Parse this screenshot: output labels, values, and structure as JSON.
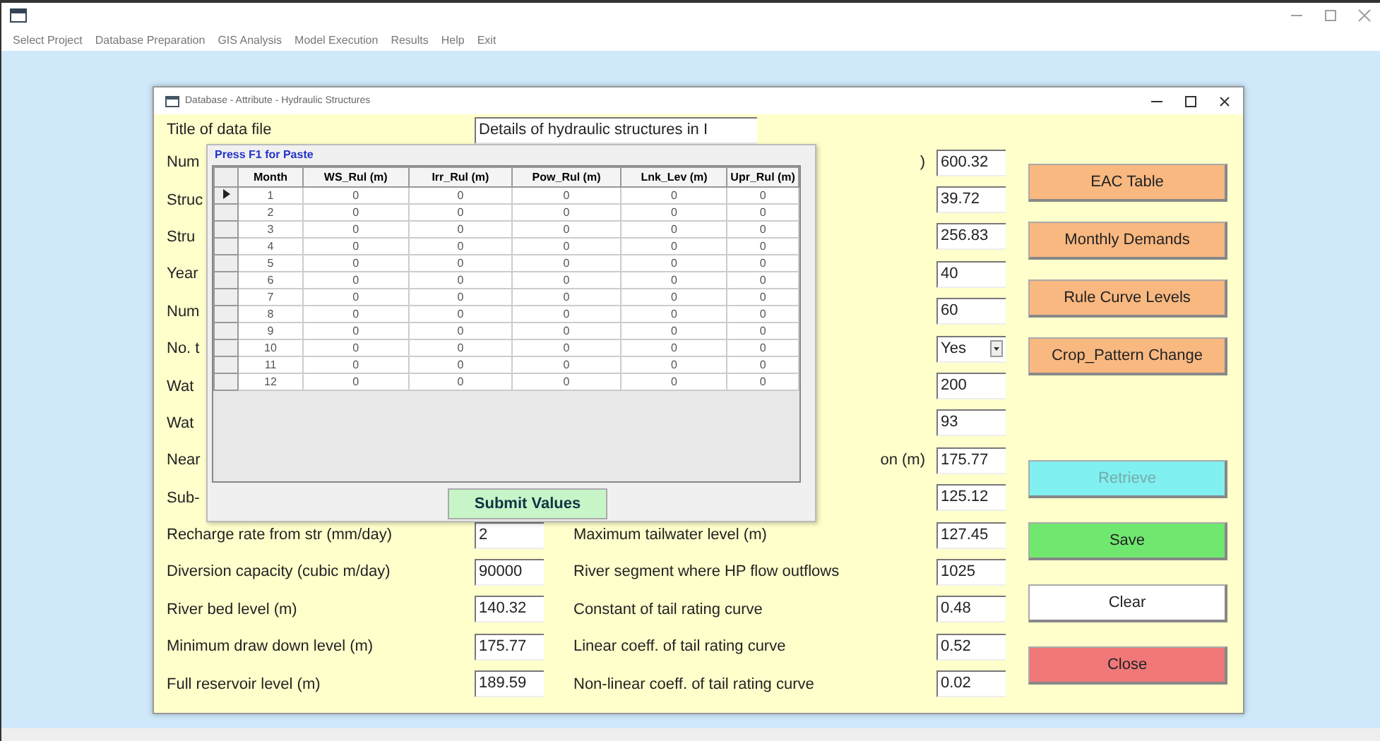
{
  "app": {
    "menu": [
      "Select Project",
      "Database Preparation",
      "GIS Analysis",
      "Model Execution",
      "Results",
      "Help",
      "Exit"
    ]
  },
  "dialog": {
    "title": "Database - Attribute - Hydraulic Structures",
    "title_field": {
      "label": "Title of data file",
      "value": "Details of hydraulic structures in I"
    },
    "left_rows": [
      {
        "label": "Num"
      },
      {
        "label": "Struc"
      },
      {
        "label": "Stru"
      },
      {
        "label": "Year"
      },
      {
        "label": "Num"
      },
      {
        "label": "No. t"
      },
      {
        "label": "Wat"
      },
      {
        "label": "Wat"
      },
      {
        "label": "Near"
      },
      {
        "label": "Sub-"
      },
      {
        "label": "Recharge rate from str (mm/day)",
        "value": "2"
      },
      {
        "label": "Diversion capacity (cubic m/day)",
        "value": "90000"
      },
      {
        "label": "River bed level (m)",
        "value": "140.32"
      },
      {
        "label": "Minimum draw down level (m)",
        "value": "175.77"
      },
      {
        "label": "Full reservoir level (m)",
        "value": "189.59"
      }
    ],
    "right_rows": [
      {
        "label": ")",
        "value": "600.32",
        "kind": "text"
      },
      {
        "value": "39.72",
        "kind": "text"
      },
      {
        "value": "256.83",
        "kind": "text"
      },
      {
        "value": "40",
        "kind": "text"
      },
      {
        "value": "60",
        "kind": "text"
      },
      {
        "value": "Yes",
        "kind": "combo"
      },
      {
        "value": "200",
        "kind": "text"
      },
      {
        "value": "93",
        "kind": "text"
      },
      {
        "label": "on (m)",
        "value": "175.77",
        "kind": "text"
      },
      {
        "value": "125.12",
        "kind": "text"
      },
      {
        "label": "Maximum tailwater level (m)",
        "value": "127.45",
        "kind": "text"
      },
      {
        "label": "River segment where HP flow outflows",
        "value": "1025",
        "kind": "text"
      },
      {
        "label": "Constant of tail rating curve",
        "value": "0.48",
        "kind": "text"
      },
      {
        "label": "Linear coeff. of tail rating curve",
        "value": "0.52",
        "kind": "text"
      },
      {
        "label": "Non-linear coeff. of tail rating curve",
        "value": "0.02",
        "kind": "text"
      }
    ],
    "table_buttons": [
      {
        "label": "EAC Table",
        "color": "#f8b880",
        "disabled": false
      },
      {
        "label": "Monthly Demands",
        "color": "#f8b880",
        "disabled": false
      },
      {
        "label": "Rule Curve Levels",
        "color": "#f8b880",
        "disabled": false
      },
      {
        "label": "Crop_Pattern Change",
        "color": "#f8b880",
        "disabled": false
      }
    ],
    "buttons": [
      {
        "label": "Retrieve",
        "color": "#80f0f0",
        "disabled": true
      },
      {
        "label": "Save",
        "color": "#70e870",
        "disabled": false
      },
      {
        "label": "Clear",
        "color": "#ffffff",
        "disabled": false
      },
      {
        "label": "Close",
        "color": "#f07878",
        "disabled": false
      }
    ],
    "grid_panel": {
      "caption": "Press F1 for Paste",
      "submit": "Submit Values",
      "columns": [
        "Month",
        "WS_Rul (m)",
        "Irr_Rul (m)",
        "Pow_Rul (m)",
        "Lnk_Lev (m)",
        "Upr_Rul (m)"
      ],
      "rows": [
        {
          "cells": [
            "1",
            "0",
            "0",
            "0",
            "0",
            "0"
          ],
          "selected": true
        },
        {
          "cells": [
            "2",
            "0",
            "0",
            "0",
            "0",
            "0"
          ],
          "selected": false
        },
        {
          "cells": [
            "3",
            "0",
            "0",
            "0",
            "0",
            "0"
          ],
          "selected": false
        },
        {
          "cells": [
            "4",
            "0",
            "0",
            "0",
            "0",
            "0"
          ],
          "selected": false
        },
        {
          "cells": [
            "5",
            "0",
            "0",
            "0",
            "0",
            "0"
          ],
          "selected": false
        },
        {
          "cells": [
            "6",
            "0",
            "0",
            "0",
            "0",
            "0"
          ],
          "selected": false
        },
        {
          "cells": [
            "7",
            "0",
            "0",
            "0",
            "0",
            "0"
          ],
          "selected": false
        },
        {
          "cells": [
            "8",
            "0",
            "0",
            "0",
            "0",
            "0"
          ],
          "selected": false
        },
        {
          "cells": [
            "9",
            "0",
            "0",
            "0",
            "0",
            "0"
          ],
          "selected": false
        },
        {
          "cells": [
            "10",
            "0",
            "0",
            "0",
            "0",
            "0"
          ],
          "selected": false
        },
        {
          "cells": [
            "11",
            "0",
            "0",
            "0",
            "0",
            "0"
          ],
          "selected": false
        },
        {
          "cells": [
            "12",
            "0",
            "0",
            "0",
            "0",
            "0"
          ],
          "selected": false
        }
      ]
    }
  }
}
